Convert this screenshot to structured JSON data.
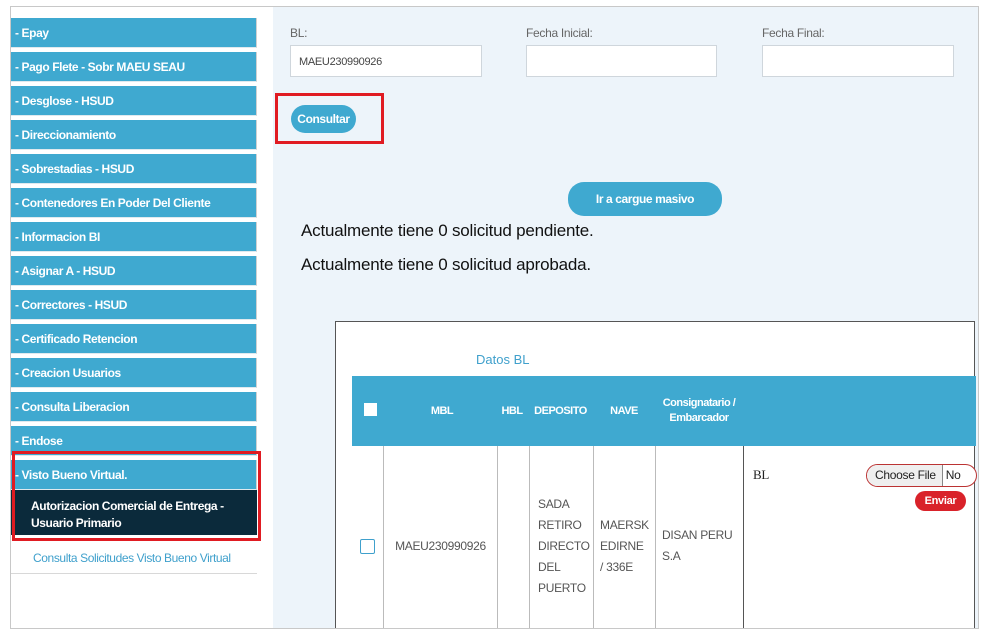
{
  "sidebar": {
    "items": [
      {
        "label": "- Epay"
      },
      {
        "label": "- Pago Flete - Sobr MAEU SEAU"
      },
      {
        "label": "- Desglose - HSUD"
      },
      {
        "label": "- Direccionamiento"
      },
      {
        "label": "- Sobrestadias - HSUD"
      },
      {
        "label": "- Contenedores En Poder Del Cliente"
      },
      {
        "label": "- Informacion BI"
      },
      {
        "label": "- Asignar A - HSUD"
      },
      {
        "label": "- Correctores - HSUD"
      },
      {
        "label": "- Certificado Retencion"
      },
      {
        "label": "- Creacion Usuarios"
      },
      {
        "label": "- Consulta Liberacion"
      },
      {
        "label": "- Endose"
      },
      {
        "label": "- Visto Bueno Virtual."
      }
    ],
    "subitems": [
      {
        "label": "Autorizacion Comercial de Entrega - Usuario Primario"
      },
      {
        "label": "Consulta Solicitudes Visto Bueno Virtual"
      }
    ]
  },
  "form": {
    "bl_label": "BL:",
    "bl_value": "MAEU230990926",
    "fecha_inicial_label": "Fecha Inicial:",
    "fecha_inicial_value": "",
    "fecha_final_label": "Fecha Final:",
    "fecha_final_value": "",
    "consultar_label": "Consultar",
    "cargue_label": "Ir a cargue masivo"
  },
  "messages": {
    "pending": "Actualmente tiene 0 solicitud pendiente.",
    "approved": "Actualmente tiene 0 solicitud aprobada."
  },
  "table": {
    "title": "Datos BL",
    "headers": {
      "mbl": "MBL",
      "hbl": "HBL",
      "deposito": "DEPOSITO",
      "nave": "NAVE",
      "consignatario": "Consignatario / Embarcador"
    },
    "row": {
      "mbl": "MAEU230990926",
      "hbl": "",
      "deposito": "SADA RETIRO DIRECTO DEL PUERTO",
      "nave": "MAERSK EDIRNE / 336E",
      "consignatario": "DISAN PERU S.A",
      "bl_label": "BL",
      "choose_file": "Choose File",
      "no_file": "No",
      "enviar": "Enviar"
    }
  },
  "colors": {
    "accent": "#3fa9d0",
    "highlight": "#e01b22",
    "submenu_bg": "#0b2a3b",
    "main_bg": "#edf4fa"
  }
}
